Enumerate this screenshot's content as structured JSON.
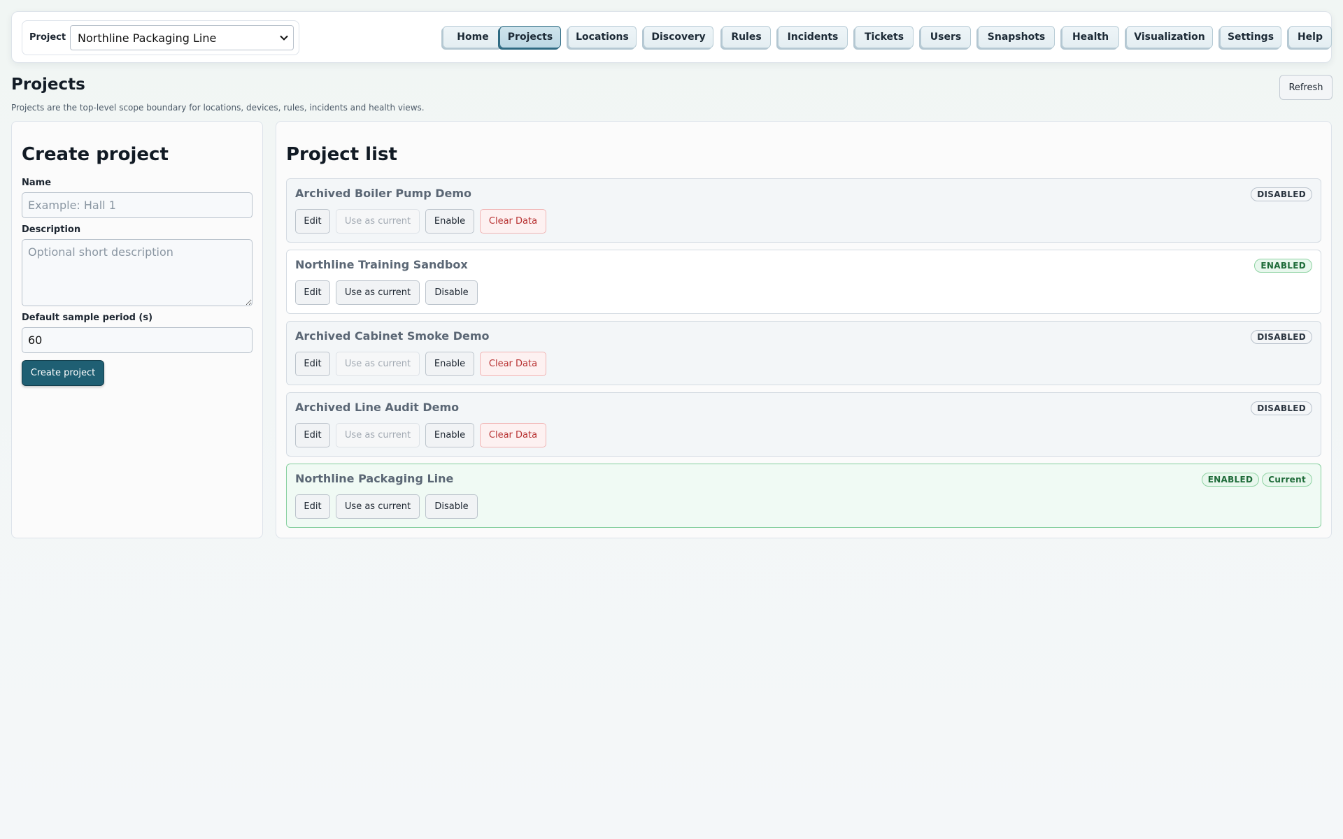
{
  "header": {
    "project_label": "Project",
    "project_selected": "Northline Packaging Line",
    "nav": [
      {
        "label": "Home"
      },
      {
        "label": "Projects",
        "active": true
      },
      {
        "label": "Locations"
      },
      {
        "label": "Discovery"
      },
      {
        "label": "Rules"
      },
      {
        "label": "Incidents"
      },
      {
        "label": "Tickets"
      },
      {
        "label": "Users"
      },
      {
        "label": "Snapshots"
      },
      {
        "label": "Health"
      },
      {
        "label": "Visualization"
      },
      {
        "label": "Settings"
      },
      {
        "label": "Help"
      }
    ]
  },
  "page": {
    "title": "Projects",
    "subtitle": "Projects are the top-level scope boundary for locations, devices, rules, incidents and health views.",
    "refresh_label": "Refresh"
  },
  "create_form": {
    "heading": "Create project",
    "name_label": "Name",
    "name_placeholder": "Example: Hall 1",
    "description_label": "Description",
    "description_placeholder": "Optional short description",
    "period_label": "Default sample period (s)",
    "period_value": "60",
    "submit_label": "Create project"
  },
  "project_list": {
    "heading": "Project list",
    "actions": {
      "edit": "Edit",
      "use_current": "Use as current",
      "enable": "Enable",
      "disable": "Disable",
      "clear_data": "Clear Data"
    },
    "badges": {
      "disabled": "DISABLED",
      "enabled": "ENABLED",
      "current": "Current"
    },
    "projects": [
      {
        "name": "Archived Boiler Pump Demo",
        "status": "DISABLED"
      },
      {
        "name": "Northline Training Sandbox",
        "status": "ENABLED"
      },
      {
        "name": "Archived Cabinet Smoke Demo",
        "status": "DISABLED"
      },
      {
        "name": "Archived Line Audit Demo",
        "status": "DISABLED"
      },
      {
        "name": "Northline Packaging Line",
        "status": "ENABLED",
        "current": true
      }
    ]
  }
}
